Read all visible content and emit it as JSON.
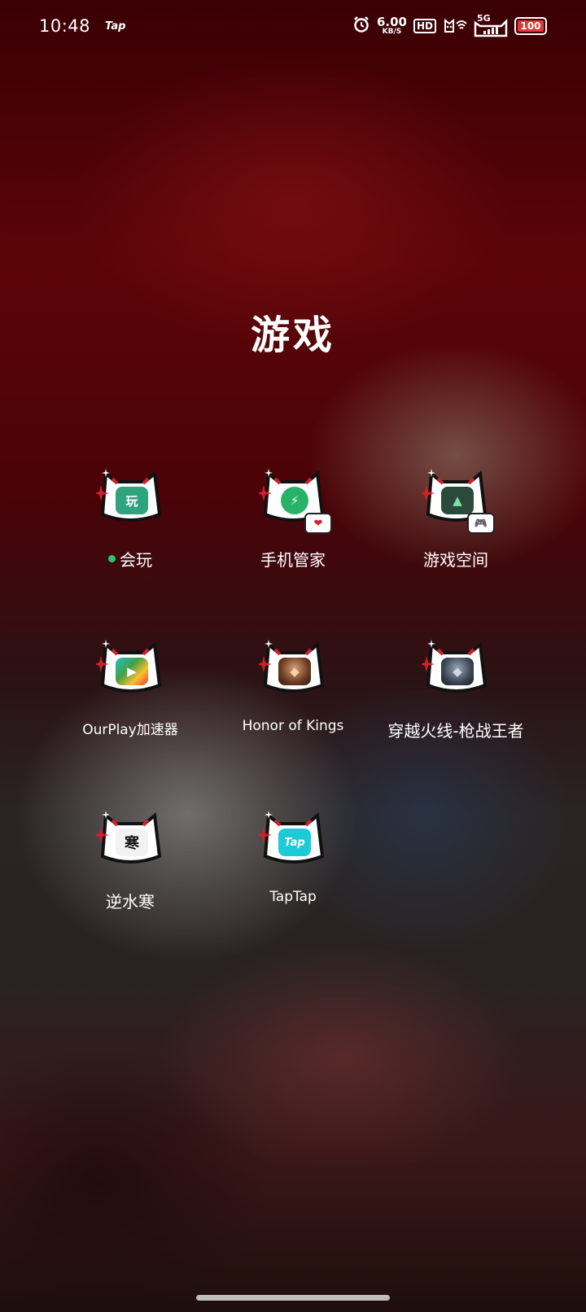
{
  "status_bar": {
    "time": "10:48",
    "notification_text": "Tap",
    "icons": [
      "alarm-icon",
      "hd-icon",
      "cat-wifi-icon",
      "signal-5g-icon",
      "battery-icon"
    ],
    "network_speed": "6.00",
    "network_speed_unit": "KB/S",
    "hd_label": "HD",
    "signal_label": "5G",
    "battery": "100"
  },
  "folder": {
    "title": "游戏",
    "apps": [
      {
        "label": "会玩",
        "icon": "huiwan-icon",
        "glyph": "玩",
        "has_new_dot": true
      },
      {
        "label": "手机管家",
        "icon": "phone-manager-icon",
        "glyph": "⚡",
        "badge_icon": "red-badge-icon"
      },
      {
        "label": "游戏空间",
        "icon": "game-space-icon",
        "glyph": "▲",
        "badge_icon": "gamepad-badge-icon"
      },
      {
        "label": "OurPlay加速器",
        "icon": "ourplay-icon",
        "glyph": "▶"
      },
      {
        "label": "Honor of Kings",
        "icon": "honor-of-kings-icon",
        "glyph": "◆"
      },
      {
        "label": "穿越火线-枪战王者",
        "icon": "crossfire-icon",
        "glyph": "◆"
      },
      {
        "label": "逆水寒",
        "icon": "nishuihan-icon",
        "glyph": "寒"
      },
      {
        "label": "TapTap",
        "icon": "taptap-icon",
        "glyph": "Tap"
      }
    ]
  },
  "colors": {
    "accent_green": "#31c26b",
    "cat_red": "#d21e2c",
    "background_red": "#5b0408"
  }
}
